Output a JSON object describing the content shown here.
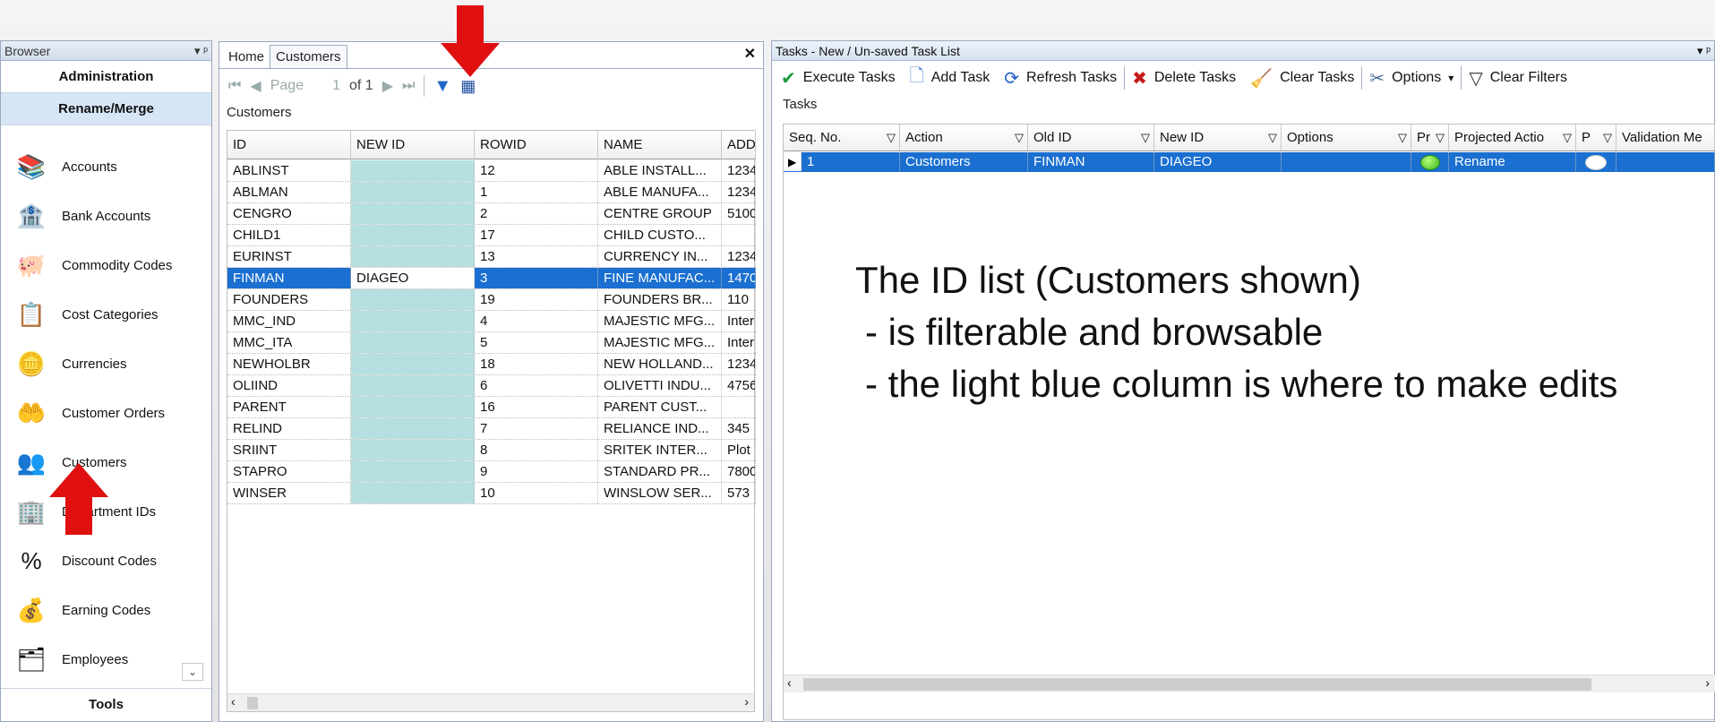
{
  "browser": {
    "title": "Browser",
    "pin": "▾ ᵖ",
    "groups": [
      "Administration",
      "Rename/Merge"
    ],
    "items": [
      {
        "label": "Accounts",
        "icon": "accounts-books-icon",
        "glyph": "📚"
      },
      {
        "label": "Bank Accounts",
        "icon": "bank-icon",
        "glyph": "🏦"
      },
      {
        "label": "Commodity Codes",
        "icon": "piggy-bank-icon",
        "glyph": "🐖"
      },
      {
        "label": "Cost Categories",
        "icon": "checklist-icon",
        "glyph": "📋"
      },
      {
        "label": "Currencies",
        "icon": "coins-icon",
        "glyph": "🪙"
      },
      {
        "label": "Customer Orders",
        "icon": "hand-money-icon",
        "glyph": "🤲"
      },
      {
        "label": "Customers",
        "icon": "people-icon",
        "glyph": "👥"
      },
      {
        "label": "Department IDs",
        "icon": "department-icon",
        "glyph": "🏢"
      },
      {
        "label": "Discount Codes",
        "icon": "percent-icon",
        "glyph": "%"
      },
      {
        "label": "Earning Codes",
        "icon": "hand-coins-icon",
        "glyph": "💰"
      },
      {
        "label": "Employees",
        "icon": "employees-icon",
        "glyph": "🗂"
      }
    ],
    "tools": "Tools"
  },
  "customers": {
    "tabs": [
      "Home",
      "Customers"
    ],
    "close": "✕",
    "pager": {
      "page_label": "Page",
      "page": "1",
      "of": "of 1"
    },
    "group_label": "Customers",
    "columns": [
      "ID",
      "NEW ID",
      "ROWID",
      "NAME",
      "ADD"
    ],
    "rows": [
      [
        "ABLINST",
        "",
        "12",
        "ABLE INSTALL...",
        "1234"
      ],
      [
        "ABLMAN",
        "",
        "1",
        "ABLE MANUFA...",
        "1234"
      ],
      [
        "CENGRO",
        "",
        "2",
        "CENTRE GROUP",
        "5100"
      ],
      [
        "CHILD1",
        "",
        "17",
        "CHILD CUSTO...",
        ""
      ],
      [
        "EURINST",
        "",
        "13",
        "CURRENCY IN...",
        "1234"
      ],
      [
        "FINMAN",
        "DIAGEO",
        "3",
        "FINE MANUFAC...",
        "1470"
      ],
      [
        "FOUNDERS",
        "",
        "19",
        "FOUNDERS BR...",
        "110"
      ],
      [
        "MMC_IND",
        "",
        "4",
        "MAJESTIC MFG...",
        "Inter"
      ],
      [
        "MMC_ITA",
        "",
        "5",
        "MAJESTIC MFG...",
        "Inter"
      ],
      [
        "NEWHOLBR",
        "",
        "18",
        "NEW HOLLAND...",
        "1234"
      ],
      [
        "OLIIND",
        "",
        "6",
        "OLIVETTI INDU...",
        "4756"
      ],
      [
        "PARENT",
        "",
        "16",
        "PARENT CUST...",
        ""
      ],
      [
        "RELIND",
        "",
        "7",
        "RELIANCE IND...",
        "345"
      ],
      [
        "SRIINT",
        "",
        "8",
        "SRITEK INTER...",
        "Plot"
      ],
      [
        "STAPRO",
        "",
        "9",
        "STANDARD PR...",
        "7800"
      ],
      [
        "WINSER",
        "",
        "10",
        "WINSLOW SER...",
        "573"
      ]
    ],
    "selected_row": 5
  },
  "tasks": {
    "title": "Tasks - New / Un-saved Task List",
    "pin": "▾ ᵖ",
    "toolbar": [
      {
        "label": "Execute Tasks",
        "icon": "check-circle-icon",
        "glyph": "✔",
        "color": "#1a9a3a"
      },
      {
        "label": "Add Task",
        "icon": "new-document-icon",
        "glyph": "🗋",
        "color": "#5a8fd0"
      },
      {
        "label": "Refresh Tasks",
        "icon": "refresh-icon",
        "glyph": "⟳",
        "color": "#1f5fc4"
      },
      {
        "label": "Delete Tasks",
        "icon": "delete-x-icon",
        "glyph": "✖",
        "color": "#c41a1a"
      },
      {
        "label": "Clear Tasks",
        "icon": "broom-icon",
        "glyph": "🧹",
        "color": "#c08020"
      },
      {
        "label": "Options",
        "icon": "tools-icon",
        "glyph": "✂",
        "color": "#4a6fa0"
      },
      {
        "label": "Clear Filters",
        "icon": "filter-icon",
        "glyph": "▽",
        "color": "#333"
      }
    ],
    "group_label": "Tasks",
    "columns": [
      "Seq. No.",
      "Action",
      "Old ID",
      "New ID",
      "Options",
      "Pr",
      "Projected Actio",
      "P",
      "Validation Me"
    ],
    "row": {
      "seq": "1",
      "action": "Customers",
      "old_id": "FINMAN",
      "new_id": "DIAGEO",
      "options": "",
      "projected": "Rename"
    }
  },
  "annotation": {
    "lines": [
      "The ID list (Customers shown)",
      "- is filterable and browsable",
      "- the light blue column is where to make edits"
    ]
  },
  "colors": {
    "edit_column": "#b5dfe0",
    "selection": "#1a6fd0",
    "arrow": "#e01010"
  }
}
